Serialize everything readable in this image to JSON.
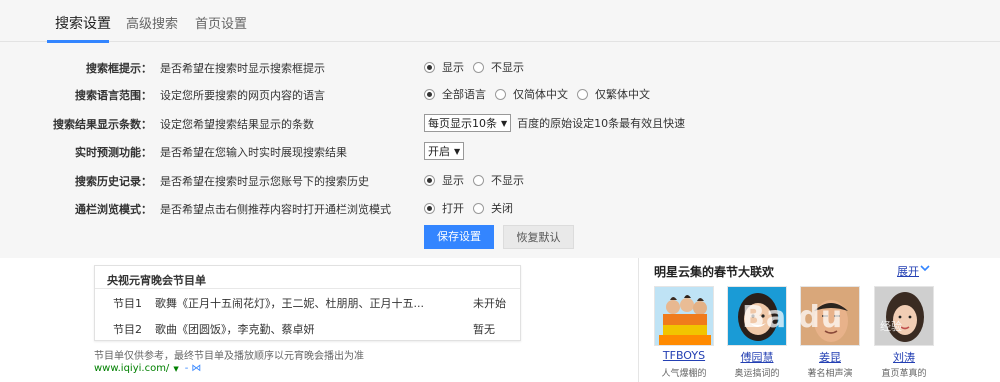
{
  "tabs": [
    {
      "label": "搜索设置"
    },
    {
      "label": "高级搜索"
    },
    {
      "label": "首页设置"
    }
  ],
  "settings": {
    "rows": [
      {
        "label": "搜索框提示：",
        "desc": "是否希望在搜索时显示搜索框提示",
        "options": [
          "显示",
          "不显示"
        ],
        "selected": 0
      },
      {
        "label": "搜索语言范围：",
        "desc": "设定您所要搜索的网页内容的语言",
        "options": [
          "全部语言",
          "仅简体中文",
          "仅繁体中文"
        ],
        "selected": 0
      },
      {
        "label": "搜索结果显示条数：",
        "desc": "设定您希望搜索结果显示的条数",
        "select_value": "每页显示10条",
        "hint": "百度的原始设定10条最有效且快速"
      },
      {
        "label": "实时预测功能：",
        "desc": "是否希望在您输入时实时展现搜索结果",
        "select_value": "开启"
      },
      {
        "label": "搜索历史记录：",
        "desc": "是否希望在搜索时显示您账号下的搜索历史",
        "options": [
          "显示",
          "不显示"
        ],
        "selected": 0
      },
      {
        "label": "通栏浏览模式：",
        "desc": "是否希望点击右侧推荐内容时打开通栏浏览模式",
        "options": [
          "打开",
          "关闭"
        ],
        "selected": 0
      }
    ],
    "save_label": "保存设置",
    "reset_label": "恢复默认"
  },
  "program": {
    "title": "央视元宵晚会节目单",
    "rows": [
      {
        "no": "节目1",
        "name": "歌舞《正月十五闹花灯》，王二妮、杜朋朋、正月十五...",
        "status": "未开始"
      },
      {
        "no": "节目2",
        "name": "歌曲《团圆饭》，李克勤、蔡卓妍",
        "status": "暂无"
      }
    ],
    "note": "节目单仅供参考，最终节目单及播放顺序以元宵晚会播出为准",
    "url": "www.iqiyi.com/"
  },
  "stars": {
    "title": "明星云集的春节大联欢",
    "expand_label": "展开",
    "items": [
      {
        "name": "TFBOYS",
        "sub": "人气爆棚的"
      },
      {
        "name": "傅园慧",
        "sub": "奥运搞词的"
      },
      {
        "name": "姜昆",
        "sub": "著名相声演"
      },
      {
        "name": "刘涛",
        "sub": "直页革真的"
      }
    ]
  },
  "watermark": {
    "text": "Baidu",
    "sub": "经验"
  },
  "colors": {
    "accent": "#3385ff",
    "link": "#2440b3",
    "url_green": "#008000",
    "panel_bg": "#f6f6f6"
  }
}
